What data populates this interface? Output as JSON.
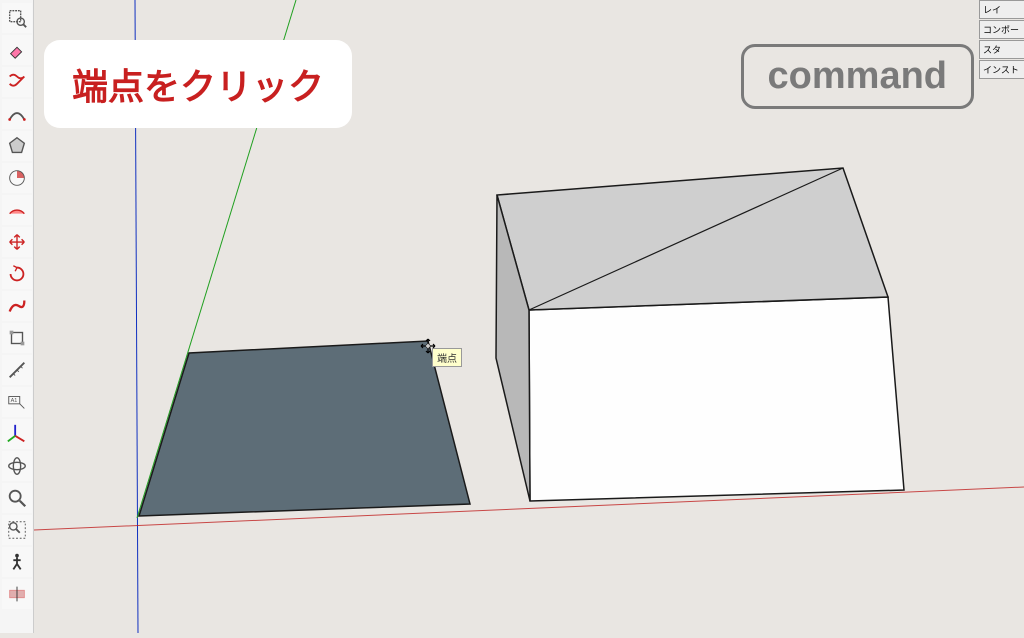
{
  "instruction_text": "端点をクリック",
  "command_text": "command",
  "tooltip_text": "端点",
  "panel_tabs": [
    "レイ",
    "コンポー",
    "スタ",
    "インスト"
  ]
}
